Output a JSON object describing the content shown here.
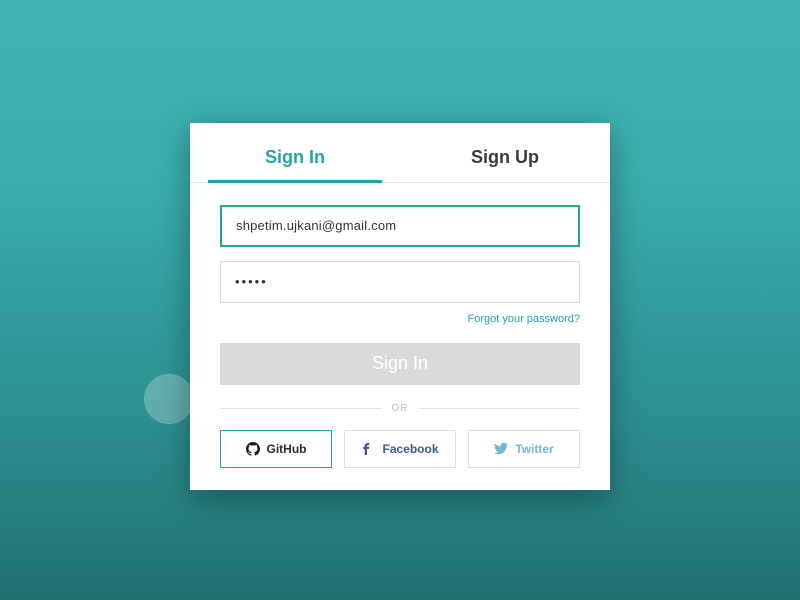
{
  "tabs": {
    "signin": "Sign In",
    "signup": "Sign Up"
  },
  "form": {
    "email_value": "shpetim.ujkani@gmail.com",
    "password_mask": "•••••",
    "forgot": "Forgot your password?",
    "submit": "Sign In"
  },
  "divider": {
    "or": "OR"
  },
  "social": {
    "github": "GitHub",
    "facebook": "Facebook",
    "twitter": "Twitter"
  },
  "colors": {
    "accent": "#22a5a6",
    "facebook": "#3b5998",
    "twitter": "#6fb9e0"
  }
}
